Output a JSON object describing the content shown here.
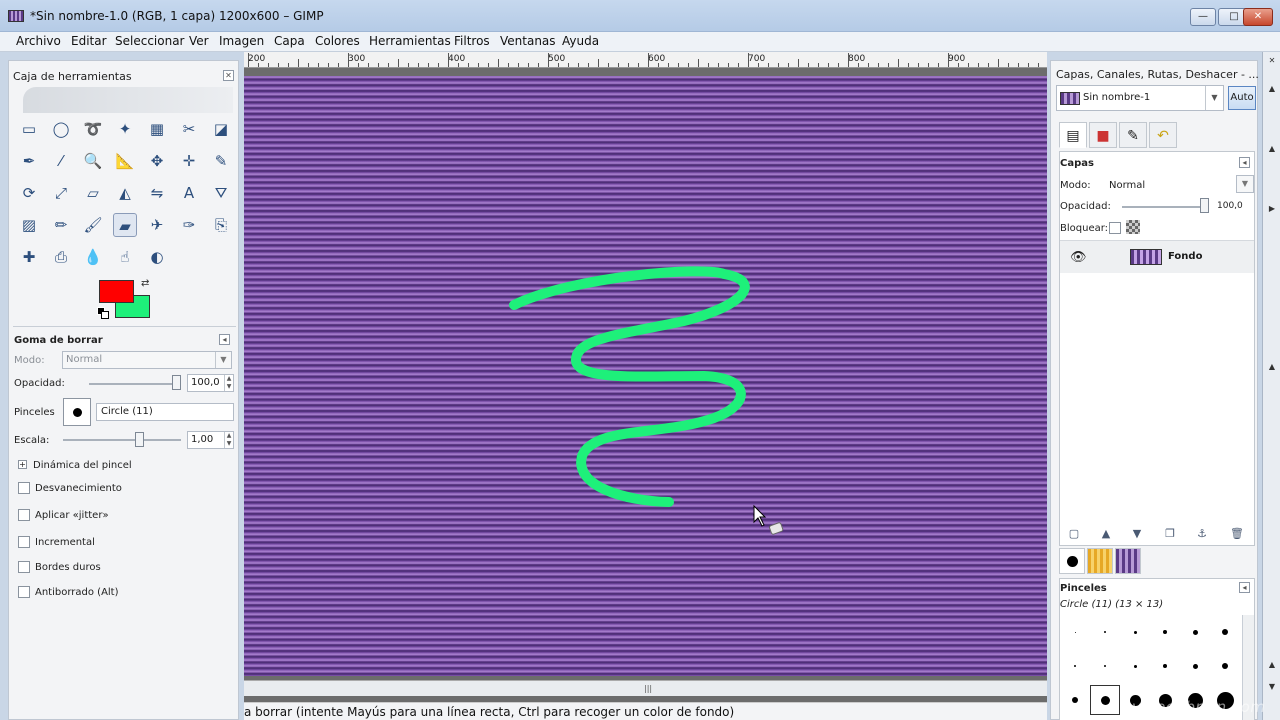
{
  "window": {
    "title": "*Sin nombre-1.0 (RGB, 1 capa) 1200x600 – GIMP",
    "minimize": "—",
    "maximize": "□",
    "close": "✕"
  },
  "menu": [
    "Archivo",
    "Editar",
    "Seleccionar",
    "Ver",
    "Imagen",
    "Capa",
    "Colores",
    "Herramientas",
    "Filtros",
    "Ventanas",
    "Ayuda"
  ],
  "toolbox": {
    "title": "Caja de herramientas",
    "foreground_color": "#ff0000",
    "background_color": "#1ef07a",
    "active_tool": "eraser",
    "tools": [
      "rect-select",
      "ellipse-select",
      "free-select",
      "fuzzy-select",
      "color-select",
      "scissors-select",
      "foreground-select",
      "paths",
      "color-picker",
      "zoom",
      "measure",
      "move",
      "align",
      "crop",
      "rotate",
      "scale",
      "shear",
      "perspective",
      "flip",
      "text",
      "bucket-fill",
      "blend",
      "pencil",
      "paintbrush",
      "eraser",
      "airbrush",
      "ink",
      "clone",
      "heal",
      "perspective-clone",
      "blur",
      "smudge",
      "dodge-burn"
    ]
  },
  "tool_options": {
    "title": "Goma de borrar",
    "mode_label": "Modo:",
    "mode_value": "Normal",
    "opacity_label": "Opacidad:",
    "opacity_value": "100,0",
    "brush_label": "Pinceles",
    "brush_value": "Circle (11)",
    "scale_label": "Escala:",
    "scale_value": "1,00",
    "dynamics_label": "Dinámica del pincel",
    "fade_label": "Desvanecimiento",
    "jitter_label": "Aplicar «jitter»",
    "incremental_label": "Incremental",
    "hard_edges_label": "Bordes duros",
    "anti_erase_label": "Antiborrado  (Alt)"
  },
  "canvas": {
    "ruler_labels": [
      "200",
      "300",
      "400",
      "500",
      "600",
      "700",
      "800",
      "900"
    ],
    "status_text": "a borrar (intente Mayús para una línea recta, Ctrl para recoger un color de fondo)",
    "stroke_color": "#1ef07a"
  },
  "dock": {
    "title": "Capas, Canales, Rutas, Deshacer - ...",
    "image_name": "Sin nombre-1",
    "auto_label": "Auto",
    "layers_title": "Capas",
    "mode_label": "Modo:",
    "mode_value": "Normal",
    "opacity_label": "Opacidad:",
    "opacity_value": "100,0",
    "lock_label": "Bloquear:",
    "layer_name": "Fondo",
    "brushes_title": "Pinceles",
    "brush_info": "Circle (11) (13 × 13)"
  },
  "watermark": "video2brain.com"
}
